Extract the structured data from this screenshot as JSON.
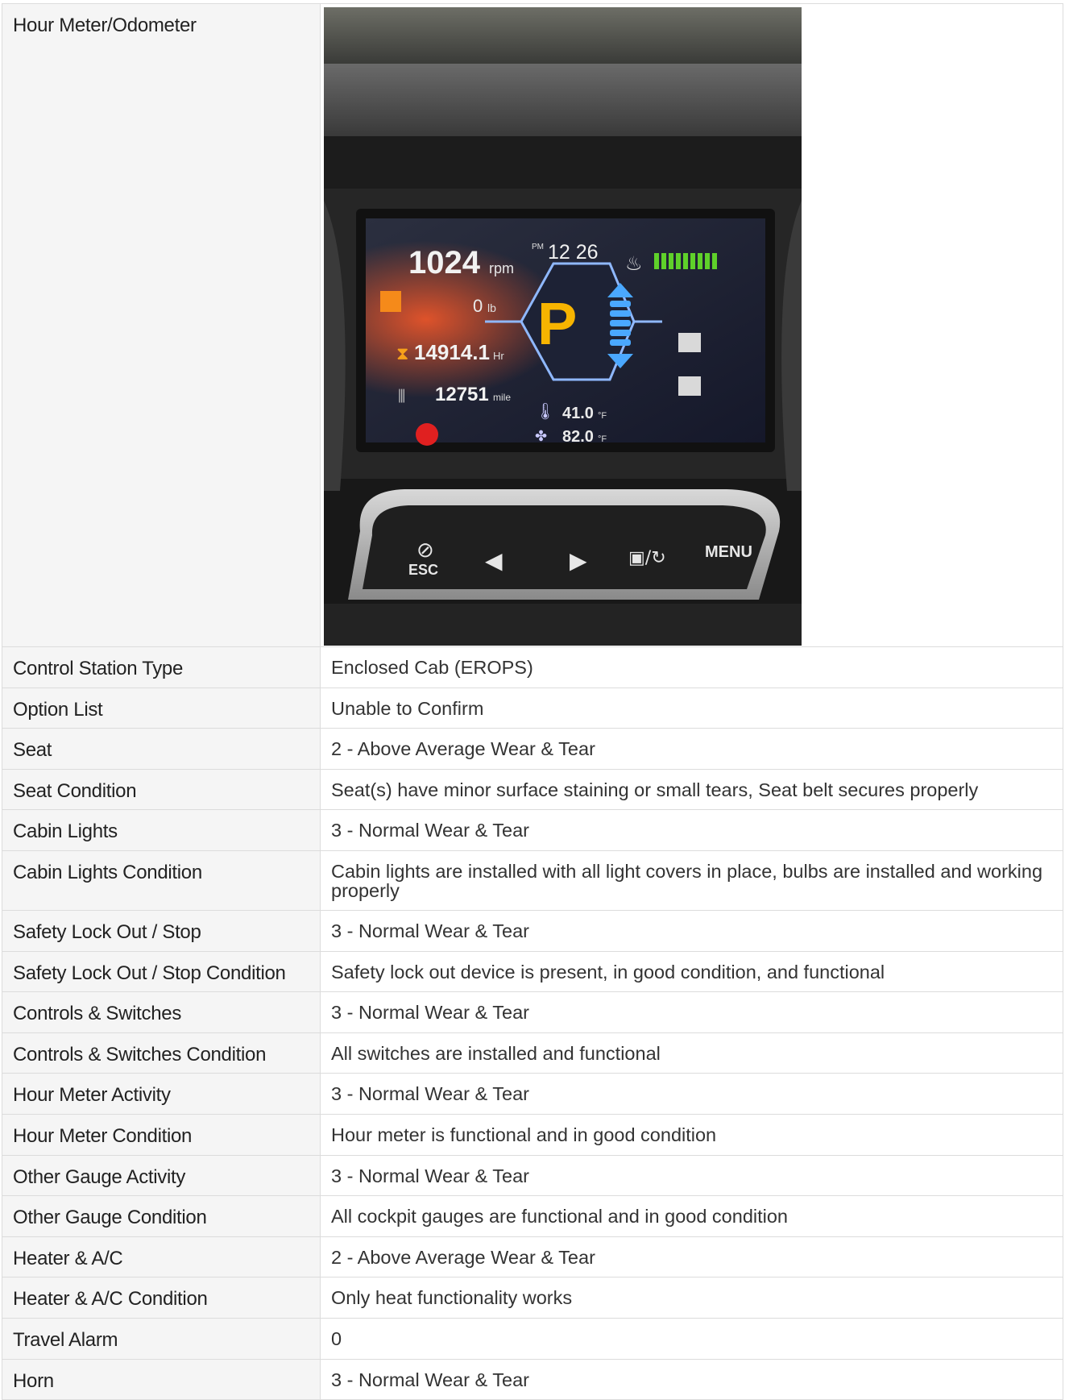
{
  "photo_row": {
    "label": "Hour Meter/Odometer",
    "display": {
      "rpm_value": "1024",
      "rpm_unit": "rpm",
      "clock_ampm": "PM",
      "clock_time": "12 26",
      "load_value": "0",
      "load_unit": "lb",
      "gear": "P",
      "hours_value": "14914.1",
      "hours_unit": "Hr",
      "odometer_value": "12751",
      "odometer_unit": "mile",
      "temp1_value": "41.0",
      "temp1_unit": "°F",
      "temp2_value": "82.0",
      "temp2_unit": "°F",
      "fuel_bars": 9
    },
    "buttons": {
      "esc": "ESC",
      "menu": "MENU"
    }
  },
  "rows": [
    {
      "label": "Control Station Type",
      "value": "Enclosed Cab (EROPS)"
    },
    {
      "label": "Option List",
      "value": "Unable to Confirm"
    },
    {
      "label": "Seat",
      "value": "2 - Above Average Wear & Tear"
    },
    {
      "label": "Seat Condition",
      "value": "Seat(s) have minor surface staining or small tears, Seat belt secures properly"
    },
    {
      "label": "Cabin Lights",
      "value": "3 - Normal Wear & Tear"
    },
    {
      "label": "Cabin Lights Condition",
      "value": "Cabin lights are installed with all light covers in place, bulbs are installed and working properly"
    },
    {
      "label": "Safety Lock Out / Stop",
      "value": "3 - Normal Wear & Tear"
    },
    {
      "label": "Safety Lock Out / Stop Condition",
      "value": "Safety lock out device is present, in good condition, and functional"
    },
    {
      "label": "Controls & Switches",
      "value": "3 - Normal Wear & Tear"
    },
    {
      "label": "Controls & Switches Condition",
      "value": "All switches are installed and functional"
    },
    {
      "label": "Hour Meter Activity",
      "value": "3 - Normal Wear & Tear"
    },
    {
      "label": "Hour Meter Condition",
      "value": "Hour meter is functional and in good condition"
    },
    {
      "label": "Other Gauge Activity",
      "value": "3 - Normal Wear & Tear"
    },
    {
      "label": "Other Gauge Condition",
      "value": "All cockpit gauges are functional and in good condition"
    },
    {
      "label": "Heater & A/C",
      "value": "2 - Above Average Wear & Tear"
    },
    {
      "label": "Heater & A/C Condition",
      "value": "Only heat functionality works"
    },
    {
      "label": "Travel Alarm",
      "value": "0"
    },
    {
      "label": "Horn",
      "value": "3 - Normal Wear & Tear"
    }
  ]
}
